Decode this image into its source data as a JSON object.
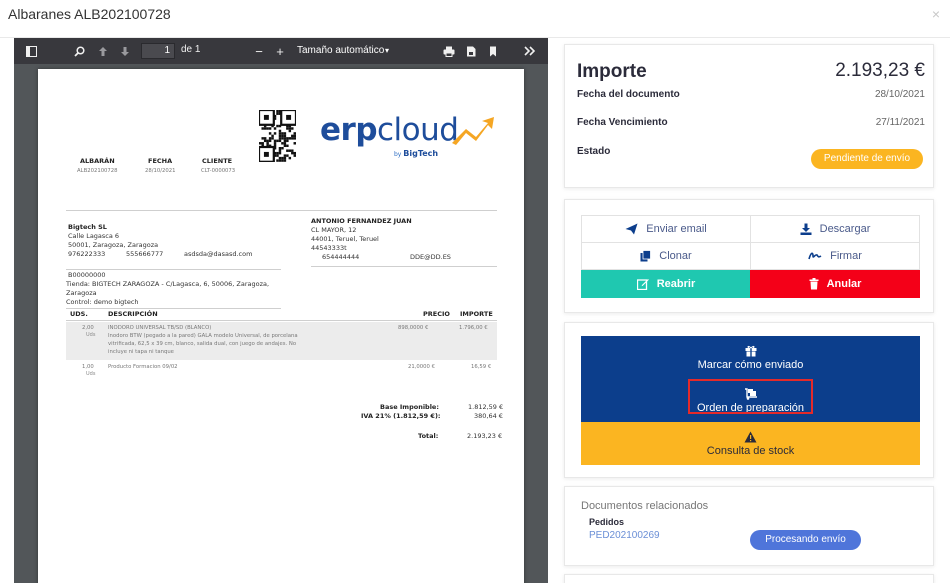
{
  "modal": {
    "title": "Albaranes ALB202100728",
    "close": "×"
  },
  "viewer": {
    "page_current": "1",
    "page_of": "de 1",
    "zoom_label": "Tamaño automático",
    "zoom_caret": "▾",
    "minus": "−",
    "plus": "+"
  },
  "doc": {
    "col_albaran": "ALBARÁN",
    "col_fecha": "FECHA",
    "col_cliente": "CLIENTE",
    "albaran": "ALB202100728",
    "fecha": "28/10/2021",
    "cliente": "CLT-0000073",
    "logo_erp": "erp",
    "logo_cloud": "cloud",
    "logo_by": "by",
    "logo_bigtech": "BigTech",
    "emisor": {
      "name": "Bigtech SL",
      "street": "Calle Lagasca 6",
      "city": "50001, Zaragoza, Zaragoza",
      "phone1": "976222333",
      "phone2": "555666777",
      "email": "asdsda@dasasd.com",
      "cif": "B00000000",
      "tienda1": "Tienda: BIGTECH ZARAGOZA - C/Lagasca, 6, 50006, Zaragoza,",
      "tienda2": "Zaragoza",
      "control": "Control: demo bigtech"
    },
    "cliente_info": {
      "name": "ANTONIO FERNANDEZ JUAN",
      "street": "CL MAYOR, 12",
      "city": "44001, Teruel, Teruel",
      "nif": "44543333t",
      "phone": "654444444",
      "email": "DDE@DD.ES"
    },
    "lines_header": {
      "uds": "UDS.",
      "desc": "DESCRIPCIÓN",
      "precio": "PRECIO",
      "importe": "IMPORTE"
    },
    "lines": [
      {
        "uds": "2,00",
        "unit": "Uds",
        "title": "INODORO UNIVERSAL TB/SD (BLANCO)",
        "desc1": "Inodoro BTW (pegado a la pared) GALA modelo Universal, de porcelana",
        "desc2": "vitrificada, 62,5 x 39 cm, blanco, salida dual, con juego de andajes. No",
        "desc3": "incluye ni tapa ni tanque",
        "precio": "898,0000 €",
        "importe": "1.796,00 €"
      },
      {
        "uds": "1,00",
        "unit": "Uds",
        "title": "Producto Formacion 09/02",
        "precio": "21,0000 €",
        "importe": "16,59 €"
      }
    ],
    "totals": {
      "base_label": "Base Imponible:",
      "base_val": "1.812,59 €",
      "iva_label": "IVA 21% (1.812,59 €):",
      "iva_val": "380,64 €",
      "total_label": "Total:",
      "total_val": "2.193,23 €"
    }
  },
  "summary": {
    "title": "Importe",
    "total": "2.193,23 €",
    "fecha_doc_label": "Fecha del documento",
    "fecha_doc": "28/10/2021",
    "fecha_venc_label": "Fecha Vencimiento",
    "fecha_venc": "27/11/2021",
    "estado_label": "Estado",
    "estado": "Pendiente de envío",
    "estado_color": "#fbb521"
  },
  "actions": {
    "email": "Enviar email",
    "download": "Descargar",
    "clone": "Clonar",
    "sign": "Firmar",
    "reopen": "Reabrir",
    "cancel": "Anular",
    "reopen_color": "#1fc8b0",
    "cancel_color": "#f40018"
  },
  "process": {
    "mark_sent": "Marcar cómo enviado",
    "prep_order": "Orden de preparación",
    "stock": "Consulta de stock",
    "blue_color": "#0c3e8c",
    "yellow_color": "#fbb521"
  },
  "related": {
    "title": "Documentos relacionados",
    "group": "Pedidos",
    "link": "PED202100269",
    "status": "Procesando envío",
    "status_color": "#4f75da"
  }
}
